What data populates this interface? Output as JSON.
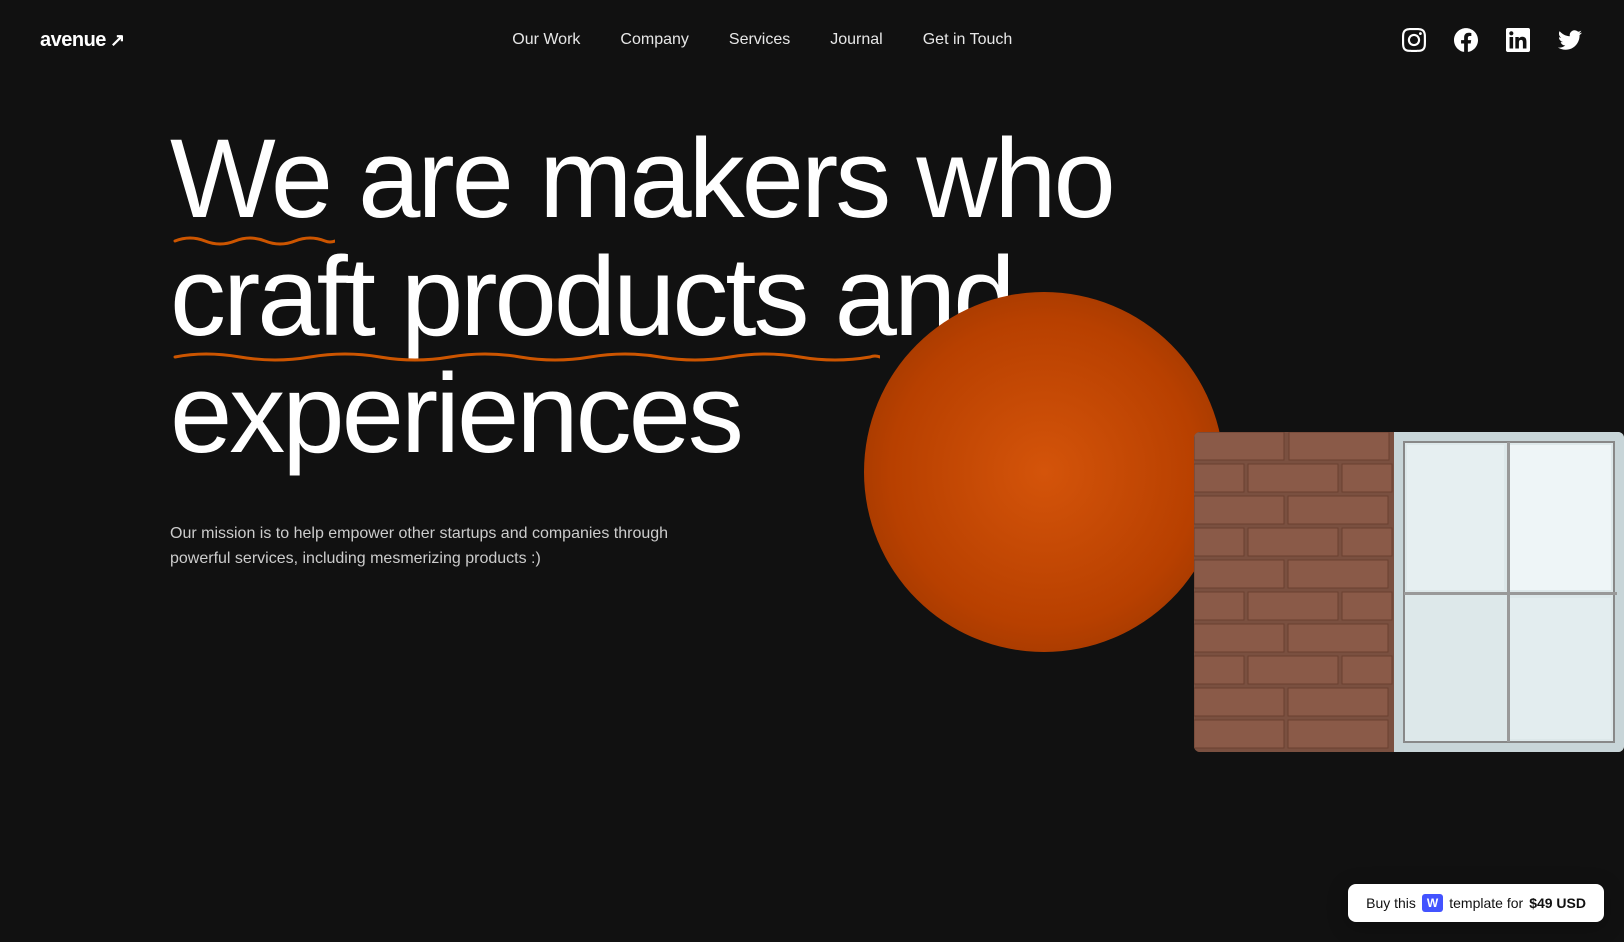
{
  "logo": {
    "text": "avenue",
    "arrow": "↗"
  },
  "nav": {
    "links": [
      {
        "label": "Our Work",
        "href": "#"
      },
      {
        "label": "Company",
        "href": "#"
      },
      {
        "label": "Services",
        "href": "#"
      },
      {
        "label": "Journal",
        "href": "#"
      },
      {
        "label": "Get in Touch",
        "href": "#"
      }
    ]
  },
  "social": {
    "instagram": "instagram-icon",
    "facebook": "facebook-icon",
    "linkedin": "linkedin-icon",
    "twitter": "twitter-icon"
  },
  "hero": {
    "headline_line1": "We are makers who",
    "headline_line2": "craft products and",
    "headline_line3": "experiences",
    "subtitle": "Our mission is to help empower other startups and companies through powerful services, including mesmerizing products :)"
  },
  "buy_badge": {
    "prefix": "Buy this",
    "w_label": "W",
    "middle": "template for",
    "price": "$49 USD"
  },
  "colors": {
    "background": "#111111",
    "accent_orange": "#cc5500",
    "text_white": "#ffffff",
    "text_muted": "#cccccc"
  }
}
